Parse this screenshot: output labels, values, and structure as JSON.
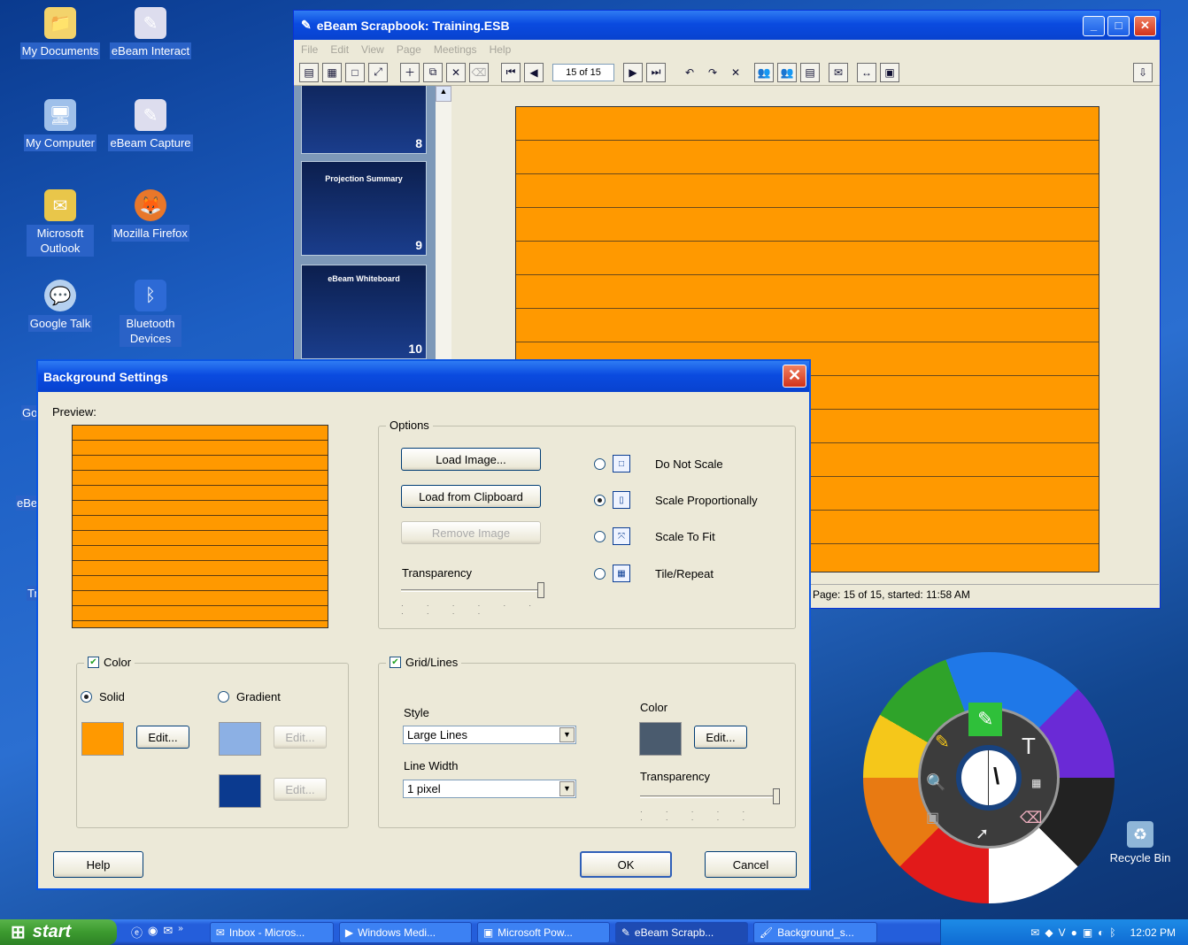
{
  "desktop": {
    "icons": [
      {
        "label": "My Documents",
        "icon": "folder-icon"
      },
      {
        "label": "eBeam Interact",
        "icon": "ebeam-interact-icon"
      },
      {
        "label": "My Computer",
        "icon": "computer-icon"
      },
      {
        "label": "eBeam Capture",
        "icon": "ebeam-capture-icon"
      },
      {
        "label": "Microsoft Outlook",
        "icon": "outlook-icon"
      },
      {
        "label": "Mozilla Firefox",
        "icon": "firefox-icon"
      },
      {
        "label": "Google Talk",
        "icon": "google-talk-icon"
      },
      {
        "label": "Bluetooth Devices",
        "icon": "bluetooth-icon"
      }
    ],
    "partial_labels": [
      "Go",
      "eBe",
      "Tr"
    ],
    "recycle_bin": "Recycle Bin"
  },
  "scrapbook": {
    "title": "eBeam Scrapbook: Training.ESB",
    "menu": [
      "File",
      "Edit",
      "View",
      "Page",
      "Meetings",
      "Help"
    ],
    "page_field": "15 of 15",
    "thumbnails": [
      {
        "title": "",
        "num": "8"
      },
      {
        "title": "Projection Summary",
        "num": "9"
      },
      {
        "title": "eBeam Whiteboard",
        "num": "10"
      }
    ],
    "status": "Page: 15 of 15, started: 11:58 AM",
    "background_color": "#ff9900"
  },
  "dialog": {
    "title": "Background Settings",
    "preview_label": "Preview:",
    "options_label": "Options",
    "load_image": "Load Image...",
    "load_clipboard": "Load from Clipboard",
    "remove_image": "Remove Image",
    "transparency": "Transparency",
    "scale_options": [
      {
        "label": "Do Not Scale",
        "selected": false
      },
      {
        "label": "Scale Proportionally",
        "selected": true
      },
      {
        "label": "Scale To Fit",
        "selected": false
      },
      {
        "label": "Tile/Repeat",
        "selected": false
      }
    ],
    "color_group": "Color",
    "solid": "Solid",
    "gradient": "Gradient",
    "edit": "Edit...",
    "colors": {
      "solid": "#ff9900",
      "gradient1": "#8cb0e4",
      "gradient2": "#0b3a8f",
      "grid": "#4a5b6e"
    },
    "grid_group": "Grid/Lines",
    "style_label": "Style",
    "style_value": "Large Lines",
    "line_width_label": "Line Width",
    "line_width_value": "1 pixel",
    "grid_color_label": "Color",
    "grid_transparency": "Transparency",
    "help": "Help",
    "ok": "OK",
    "cancel": "Cancel"
  },
  "taskbar": {
    "start": "start",
    "tasks": [
      "Inbox - Micros...",
      "Windows Medi...",
      "Microsoft Pow...",
      "eBeam Scrapb...",
      "Background_s..."
    ],
    "clock": "12:02 PM"
  }
}
